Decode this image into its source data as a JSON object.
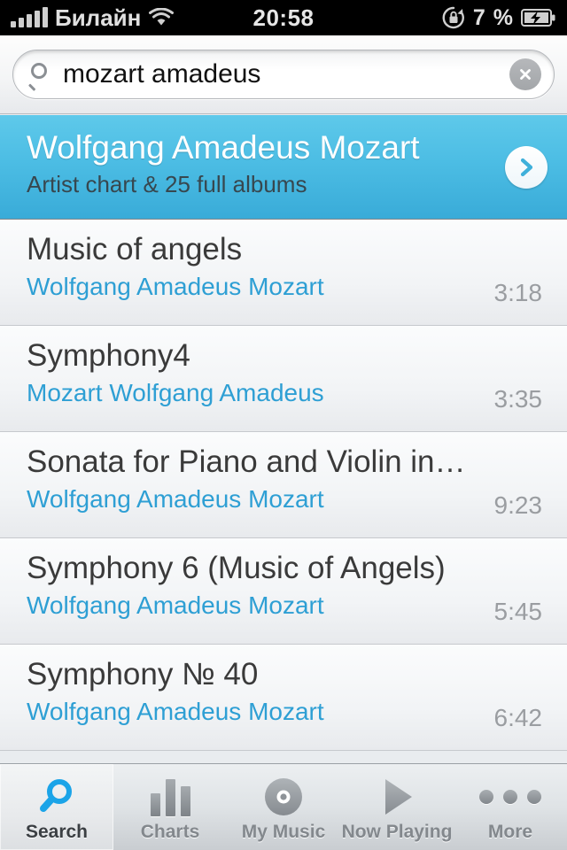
{
  "statusbar": {
    "carrier": "Билайн",
    "time": "20:58",
    "battery_percent": "7 %",
    "wifi_icon": "wifi-icon",
    "signal_icon": "signal-bars-icon",
    "rotation_lock_icon": "rotation-lock-icon",
    "battery_icon": "battery-charging-icon"
  },
  "search": {
    "value": "mozart amadeus",
    "placeholder": "Search",
    "search_icon": "search-icon",
    "clear_icon": "clear-circle-icon"
  },
  "artist_result": {
    "name": "Wolfgang Amadeus Mozart",
    "subtitle": "Artist chart & 25 full albums",
    "disclosure_icon": "chevron-right-icon"
  },
  "tracks": [
    {
      "title": "Music of angels",
      "artist": "Wolfgang Amadeus Mozart",
      "duration": "3:18"
    },
    {
      "title": "Symphony4",
      "artist": "Mozart Wolfgang Amadeus",
      "duration": "3:35"
    },
    {
      "title": "Sonata for Piano and Violin in…",
      "artist": "Wolfgang Amadeus Mozart",
      "duration": "9:23"
    },
    {
      "title": "Symphony 6 (Music of Angels)",
      "artist": "Wolfgang Amadeus Mozart",
      "duration": "5:45"
    },
    {
      "title": "Symphony № 40",
      "artist": "Wolfgang Amadeus Mozart",
      "duration": "6:42"
    }
  ],
  "tabbar": {
    "items": [
      {
        "label": "Search",
        "icon": "magnifier-icon",
        "active": true
      },
      {
        "label": "Charts",
        "icon": "bar-chart-icon",
        "active": false
      },
      {
        "label": "My Music",
        "icon": "disc-icon",
        "active": false
      },
      {
        "label": "Now Playing",
        "icon": "play-icon",
        "active": false
      },
      {
        "label": "More",
        "icon": "ellipsis-icon",
        "active": false
      }
    ]
  },
  "colors": {
    "accent_blue": "#2e9fd4",
    "highlight_row": "#4cbde4",
    "title_text": "#3a3a3a",
    "duration_text": "#9a9da1"
  }
}
